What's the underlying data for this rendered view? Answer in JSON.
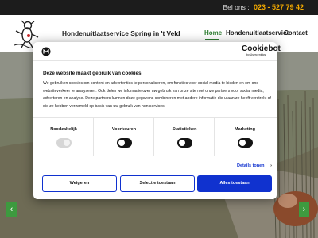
{
  "topbar": {
    "phone_label": "Bel ons :",
    "phone_number": "023 - 527 79 42"
  },
  "header": {
    "site_title": "Hondenuitlaatservice Spring in 't Veld",
    "nav": {
      "home": "Home",
      "service": "Hondenuitlaatservice",
      "contact": "Contact"
    }
  },
  "hero": {
    "prev_icon": "chevron-left-icon",
    "next_icon": "chevron-right-icon",
    "prev": "‹",
    "next": "›"
  },
  "cookie": {
    "brand": "Cookiebot",
    "brand_sub": "by Usercentrics",
    "title": "Deze website maakt gebruik van cookies",
    "body": "We gebruiken cookies om content en advertenties te personaliseren, om functies voor social media te bieden en om ons websiteverkeer te analyseren. Ook delen we informatie over uw gebruik van onze site met onze partners voor social media, adverteren en analyse. Deze partners kunnen deze gegevens combineren met andere informatie die u aan ze heeft verstrekt of die ze hebben verzameld op basis van uw gebruik van hun services.",
    "categories": [
      {
        "label": "Noodzakelijk",
        "enabled": true,
        "locked": true
      },
      {
        "label": "Voorkeuren",
        "enabled": false,
        "locked": false
      },
      {
        "label": "Statistieken",
        "enabled": false,
        "locked": false
      },
      {
        "label": "Marketing",
        "enabled": false,
        "locked": false
      }
    ],
    "details_label": "Details tonen",
    "details_chevron": "›",
    "buttons": {
      "deny": "Weigeren",
      "selection": "Selectie toestaan",
      "allow_all": "Alles toestaan"
    },
    "accent_color": "#1032cf"
  },
  "colors": {
    "nav_active": "#2e7d32",
    "phone_number": "#f2a900",
    "slider_arrow": "#3d9a3f"
  }
}
